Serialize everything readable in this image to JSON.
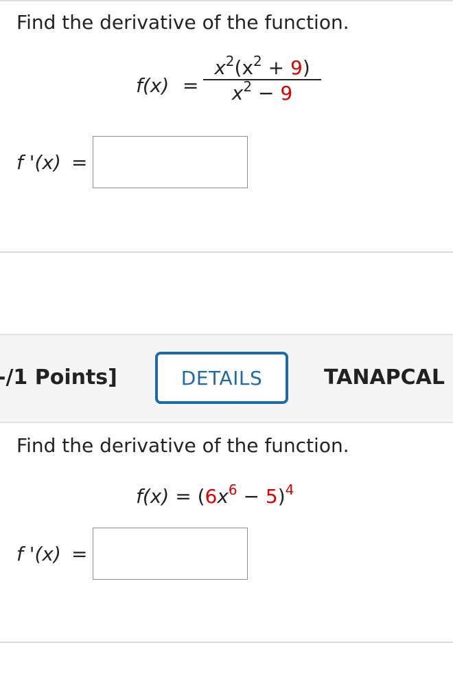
{
  "problem1": {
    "instruction": "Find the derivative of the function.",
    "function_label": "f(x)",
    "equals": "=",
    "numerator": {
      "base1": "x",
      "exp1": "2",
      "open": "(x",
      "exp2": "2",
      "plus": " + ",
      "constant": "9",
      "close": ")"
    },
    "denominator": {
      "base": "x",
      "exp": "2",
      "minus": " − ",
      "constant": "9"
    },
    "derivative_label": "f '(x)",
    "derivative_equals": "="
  },
  "problem2": {
    "points_label": "-/1 Points]",
    "details_button": "DETAILS",
    "source_label": "TANAPCAL",
    "instruction": "Find the derivative of the function.",
    "function_label": "f(x)",
    "equals": "=",
    "expr": {
      "open": "(",
      "coef": "6",
      "base": "x",
      "exp": "6",
      "minus": " − ",
      "constant": "5",
      "close": ")",
      "outer_exp": "4"
    },
    "derivative_label": "f '(x)",
    "derivative_equals": "="
  },
  "colors": {
    "accent": "#1f6aa5",
    "highlight": "#e00000"
  }
}
